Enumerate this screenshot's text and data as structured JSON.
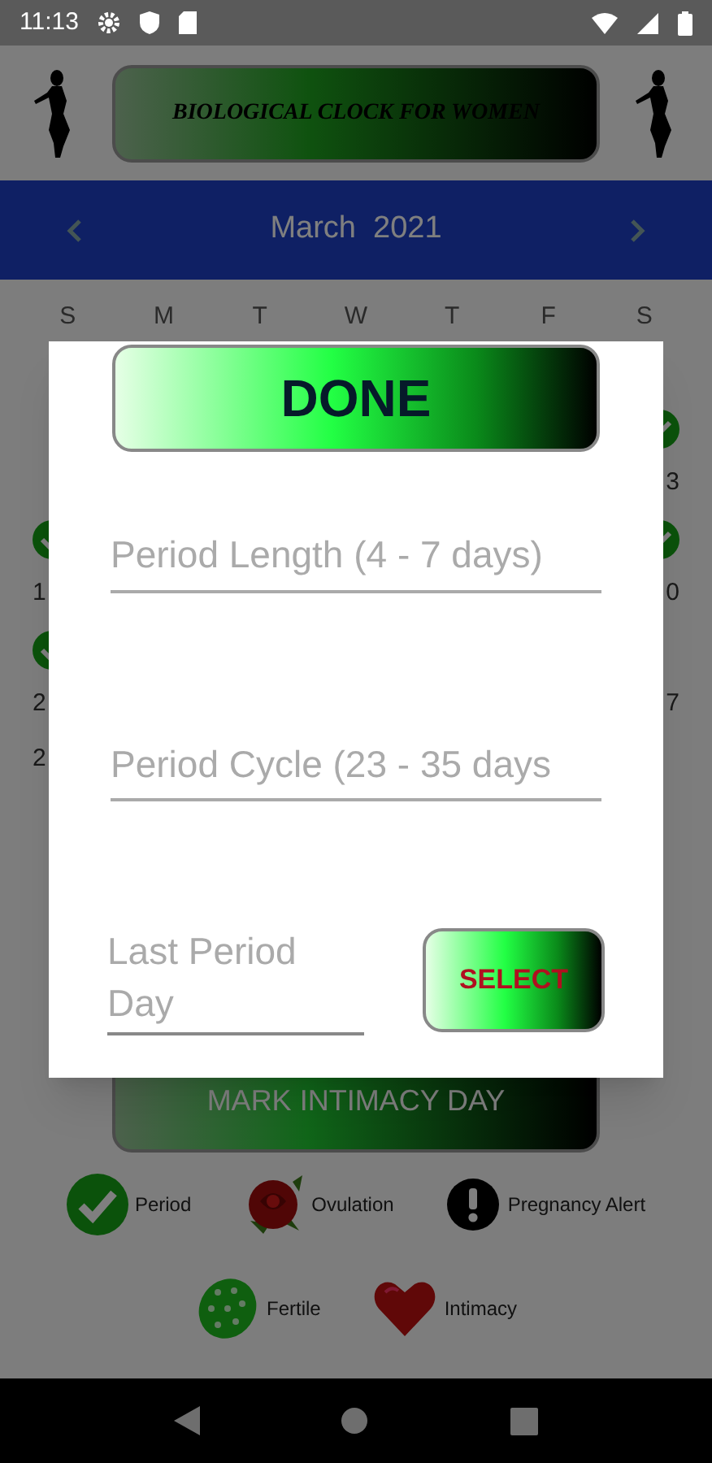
{
  "status_bar": {
    "time": "11:13"
  },
  "header": {
    "title": "BIOLOGICAL CLOCK FOR WOMEN"
  },
  "calendar": {
    "month": "March  2021",
    "weekdays": [
      "S",
      "M",
      "T",
      "W",
      "T",
      "F",
      "S"
    ],
    "edge_rows": [
      {
        "right": {
          "kind": "check"
        }
      },
      {
        "right": {
          "kind": "number",
          "text": "3"
        }
      },
      {
        "left": {
          "kind": "check"
        },
        "right": {
          "kind": "check"
        }
      },
      {
        "left": {
          "kind": "number",
          "text": "1"
        },
        "right": {
          "kind": "number",
          "text": "0"
        }
      },
      {
        "left": {
          "kind": "check"
        }
      },
      {
        "left": {
          "kind": "number",
          "text": "2"
        },
        "right": {
          "kind": "number",
          "text": "7"
        }
      },
      {
        "left": {
          "kind": "number",
          "text": "2"
        }
      }
    ]
  },
  "mark_button": "MARK INTIMACY DAY",
  "legend": [
    {
      "kind": "check",
      "label": "Period"
    },
    {
      "kind": "rose",
      "label": "Ovulation"
    },
    {
      "kind": "alert",
      "label": "Pregnancy Alert"
    },
    {
      "kind": "egg",
      "label": "Fertile"
    },
    {
      "kind": "heart",
      "label": "Intimacy"
    }
  ],
  "dialog": {
    "done_button": "DONE",
    "fields": [
      {
        "placeholder": "Period Length (4 - 7 days)"
      },
      {
        "placeholder": "Period Cycle (23 - 35 days"
      }
    ],
    "last_period": {
      "placeholder": "Last Period Day"
    },
    "select_button": "SELECT"
  }
}
